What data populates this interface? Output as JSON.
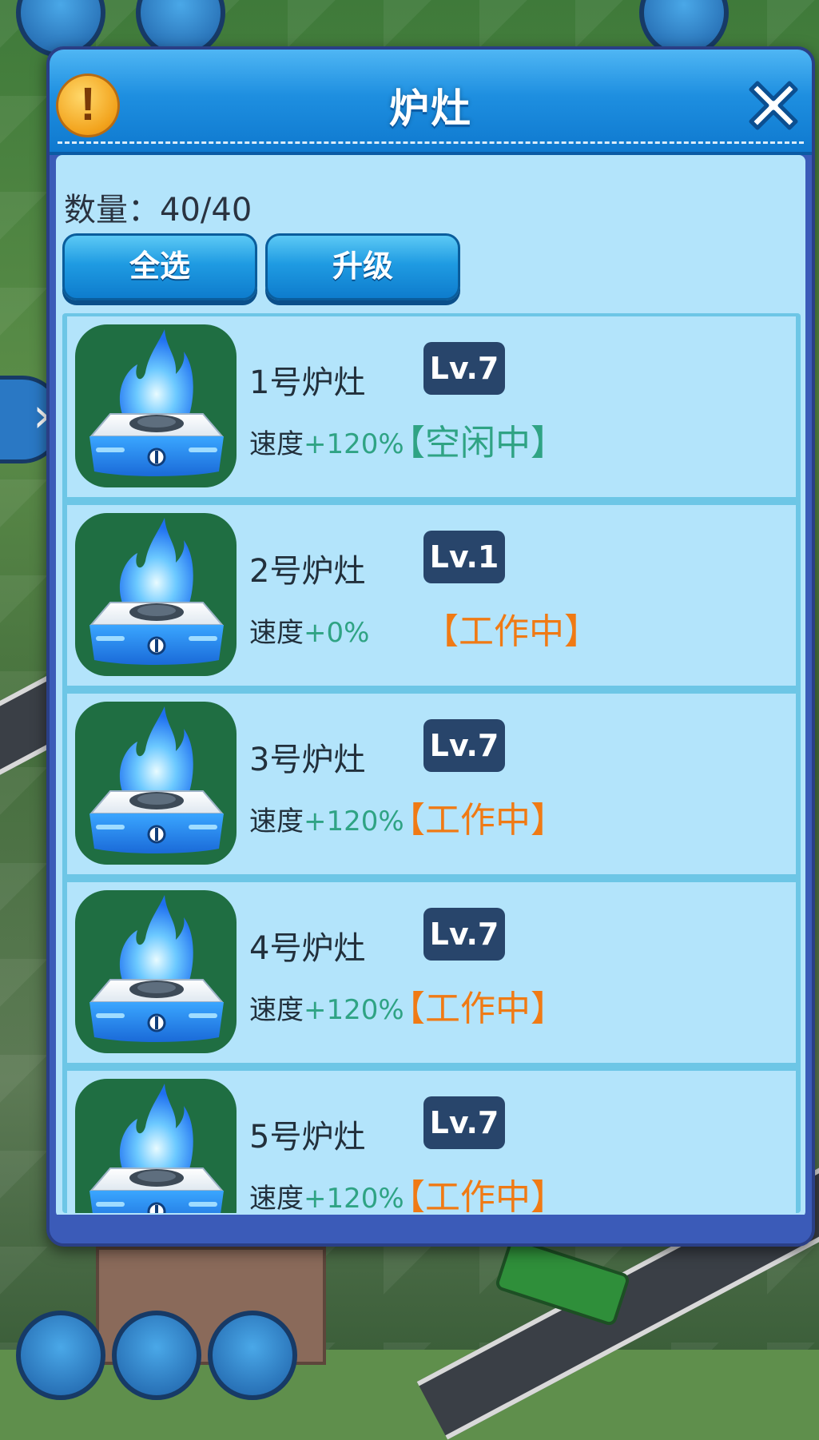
{
  "dialog": {
    "title": "炉灶",
    "count_label": "数量：40/40",
    "tabs": {
      "select_all": "全选",
      "upgrade": "升级"
    }
  },
  "icons": {
    "warning": "exclamation-icon",
    "close": "close-icon",
    "stove": "gas-stove-icon"
  },
  "colors": {
    "idle_status": "#2fa384",
    "work_status": "#f07a14",
    "level_badge": "#28456b",
    "header_blue": "#1e8fe0",
    "stove_bg": "#1f6e42"
  },
  "stoves": [
    {
      "name": "1号炉灶",
      "level": "Lv.7",
      "speed_label": "速度",
      "speed_value": "+120%",
      "status": "【空闲中】",
      "status_type": "idle"
    },
    {
      "name": "2号炉灶",
      "level": "Lv.1",
      "speed_label": "速度",
      "speed_value": "+0%",
      "status": "【工作中】",
      "status_type": "work"
    },
    {
      "name": "3号炉灶",
      "level": "Lv.7",
      "speed_label": "速度",
      "speed_value": "+120%",
      "status": "【工作中】",
      "status_type": "work"
    },
    {
      "name": "4号炉灶",
      "level": "Lv.7",
      "speed_label": "速度",
      "speed_value": "+120%",
      "status": "【工作中】",
      "status_type": "work"
    },
    {
      "name": "5号炉灶",
      "level": "Lv.7",
      "speed_label": "速度",
      "speed_value": "+120%",
      "status": "【工作中】",
      "status_type": "work"
    }
  ]
}
